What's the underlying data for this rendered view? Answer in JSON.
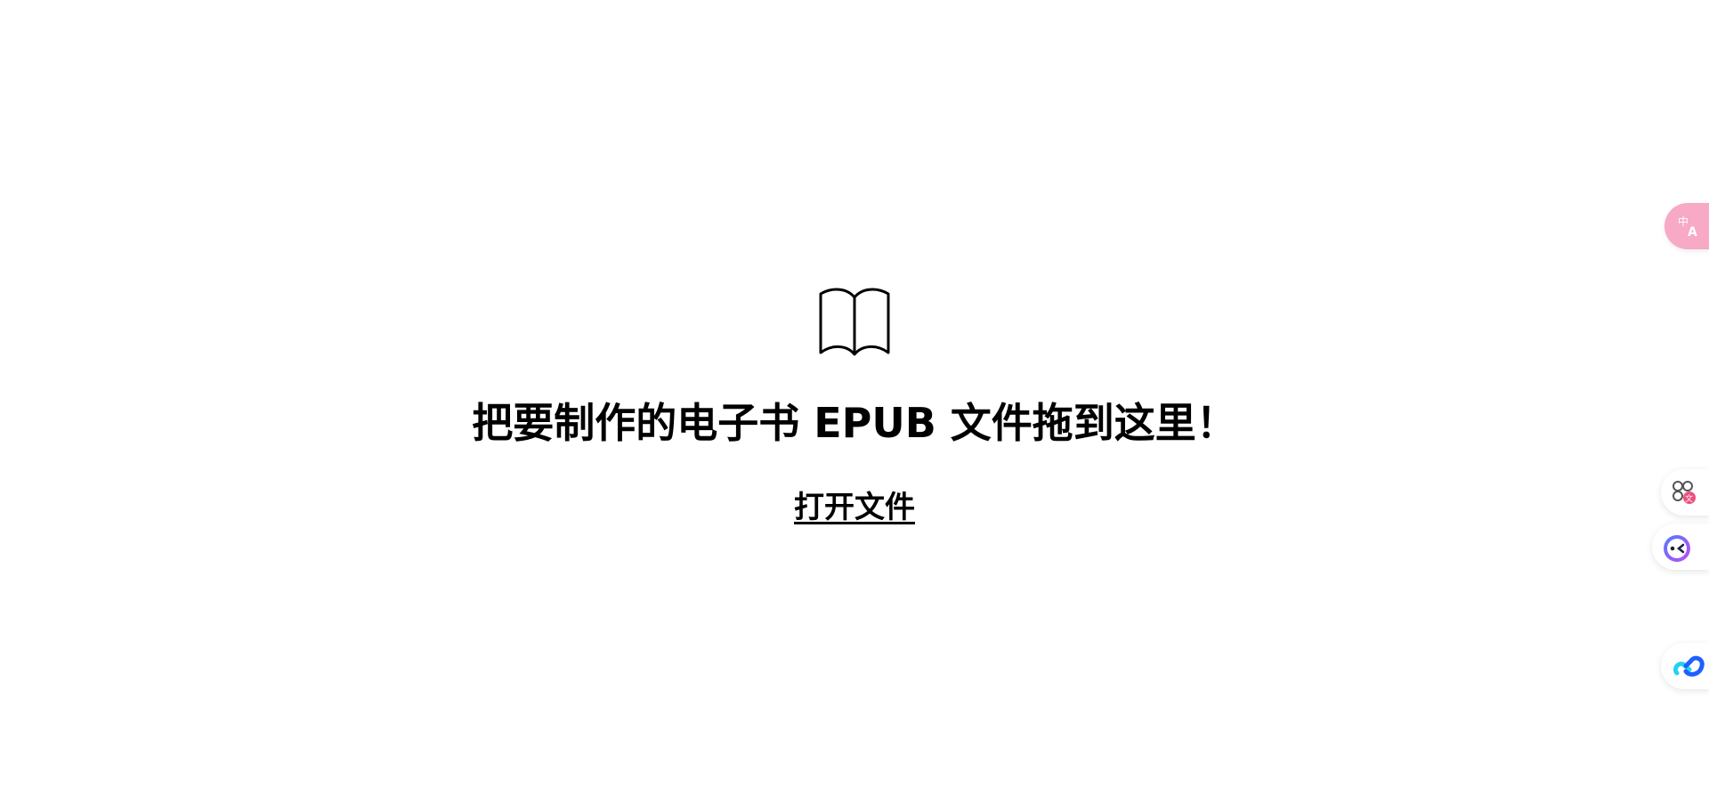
{
  "main": {
    "icon": "open-book-icon",
    "headline": "把要制作的电子书 EPUB 文件拖到这里！",
    "open_file_label": "打开文件"
  },
  "floating_widgets": {
    "translate_icon": "translate-icon",
    "apps_icon": "apps-translate-icon",
    "assistant_icon": "ai-assistant-icon",
    "link_icon": "cloud-link-icon",
    "colors": {
      "translate_bg": "#f7a9c6",
      "assistant_ring": "#6d5cf6",
      "link_blue": "#1f5fff",
      "link_cyan": "#22d3ee"
    }
  }
}
